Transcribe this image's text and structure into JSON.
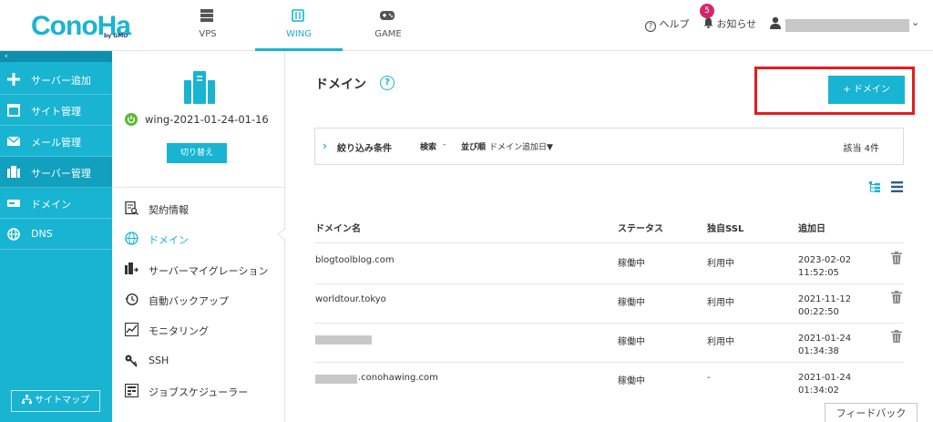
{
  "header": {
    "logo": "ConoHa",
    "logo_sub": "by GMO",
    "tabs": [
      {
        "label": "VPS"
      },
      {
        "label": "WING"
      },
      {
        "label": "GAME"
      }
    ],
    "help": "ヘルプ",
    "notice": "お知らせ",
    "notice_count": "5"
  },
  "sidebar": {
    "collapse": "‹",
    "items": [
      {
        "label": "サーバー追加"
      },
      {
        "label": "サイト管理"
      },
      {
        "label": "メール管理"
      },
      {
        "label": "サーバー管理"
      },
      {
        "label": "ドメイン"
      },
      {
        "label": "DNS"
      }
    ],
    "sitemap": "サイトマップ"
  },
  "server_panel": {
    "name": "wing-2021-01-24-01-16",
    "switch": "切り替え",
    "menu": [
      {
        "label": "契約情報"
      },
      {
        "label": "ドメイン"
      },
      {
        "label": "サーバーマイグレーション"
      },
      {
        "label": "自動バックアップ"
      },
      {
        "label": "モニタリング"
      },
      {
        "label": "SSH"
      },
      {
        "label": "ジョブスケジューラー"
      }
    ]
  },
  "main": {
    "title": "ドメイン",
    "add_button": "+ ドメイン",
    "filter": {
      "label": "絞り込み条件",
      "search_label": "検索",
      "search_value": "-",
      "sort_label": "並び順",
      "sort_value": "ドメイン追加日▼",
      "count": "該当 4件"
    },
    "table": {
      "headers": [
        "ドメイン名",
        "ステータス",
        "独自SSL",
        "追加日"
      ],
      "rows": [
        {
          "domain": "blogtoolblog.com",
          "status": "稼働中",
          "ssl": "利用中",
          "date": "2023-02-02",
          "time": "11:52:05"
        },
        {
          "domain": "worldtour.tokyo",
          "status": "稼働中",
          "ssl": "利用中",
          "date": "2021-11-12",
          "time": "00:22:50"
        },
        {
          "domain": "",
          "status": "稼働中",
          "ssl": "利用中",
          "date": "2021-01-24",
          "time": "01:34:38"
        },
        {
          "domain": ".conohawing.com",
          "status": "稼働中",
          "ssl": "-",
          "date": "2021-01-24",
          "time": "01:34:02"
        }
      ]
    },
    "feedback": "フィードバック"
  },
  "colors": {
    "brand": "#19b4d2",
    "highlight": "#e01e1e",
    "badge": "#d6256b"
  }
}
